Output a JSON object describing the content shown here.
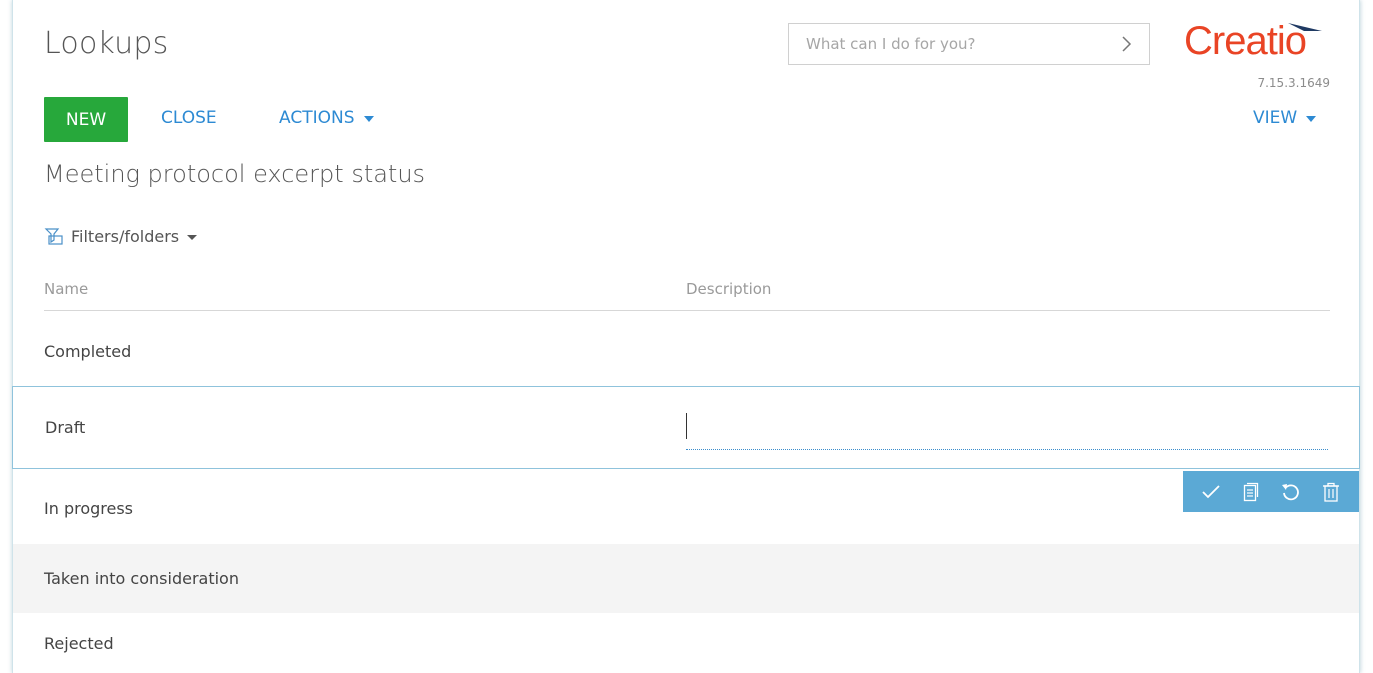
{
  "header": {
    "title": "Lookups",
    "search_placeholder": "What can I do for you?",
    "logo_text": "Creatio",
    "version": "7.15.3.1649"
  },
  "toolbar": {
    "new_label": "NEW",
    "close_label": "CLOSE",
    "actions_label": "ACTIONS",
    "view_label": "VIEW"
  },
  "lookup": {
    "title": "Meeting protocol excerpt status",
    "filters_label": "Filters/folders"
  },
  "grid": {
    "columns": {
      "name": "Name",
      "description": "Description"
    },
    "rows": [
      {
        "name": "Completed",
        "description": ""
      },
      {
        "name": "Draft",
        "description": ""
      },
      {
        "name": "In progress",
        "description": ""
      },
      {
        "name": "Taken into consideration",
        "description": ""
      },
      {
        "name": "Rejected",
        "description": ""
      }
    ]
  },
  "row_actions": [
    "save-icon",
    "copy-icon",
    "undo-icon",
    "delete-icon"
  ],
  "colors": {
    "brand": "#e94425",
    "primary_button": "#27a83b",
    "link": "#2d8ad3",
    "row_actions_bg": "#5ba9d5",
    "active_row_border": "#8fc3dc"
  }
}
